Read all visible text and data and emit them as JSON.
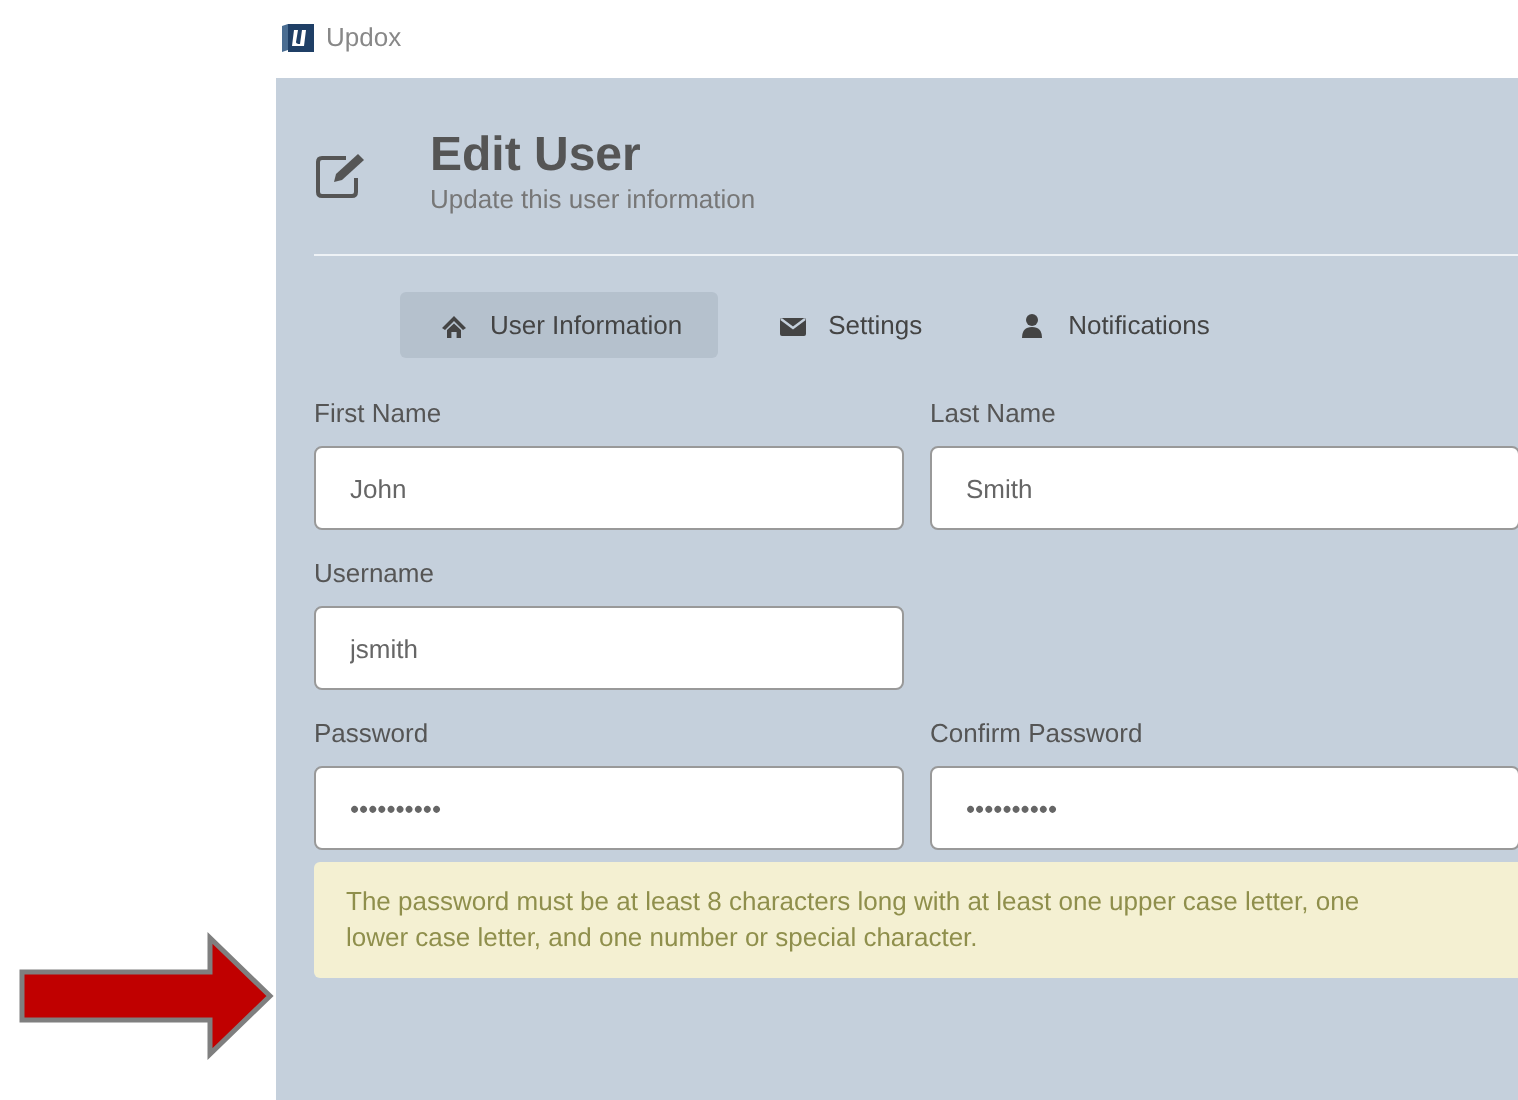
{
  "app": {
    "name": "Updox"
  },
  "header": {
    "title": "Edit User",
    "subtitle": "Update this user information"
  },
  "tabs": [
    {
      "label": "User Information",
      "kind": "home",
      "selected": true
    },
    {
      "label": "Settings",
      "kind": "mail",
      "selected": false
    },
    {
      "label": "Notifications",
      "kind": "user",
      "selected": false
    }
  ],
  "form_rows": [
    {
      "fields": [
        {
          "label": "First Name",
          "value": "John"
        },
        {
          "label": "Last Name",
          "value": "Smith"
        }
      ]
    },
    {
      "fields": [
        {
          "label": "Username",
          "value": "jsmith"
        }
      ]
    },
    {
      "fields": [
        {
          "label": "Password",
          "value": "••••••••••"
        },
        {
          "label": "Confirm Password",
          "value": "••••••••••"
        }
      ]
    }
  ],
  "notice": {
    "text": "The password must be at least 8 characters long with at least one upper case letter, one lower case letter, and one number or special character."
  },
  "annotation": {
    "kind": "arrow"
  }
}
